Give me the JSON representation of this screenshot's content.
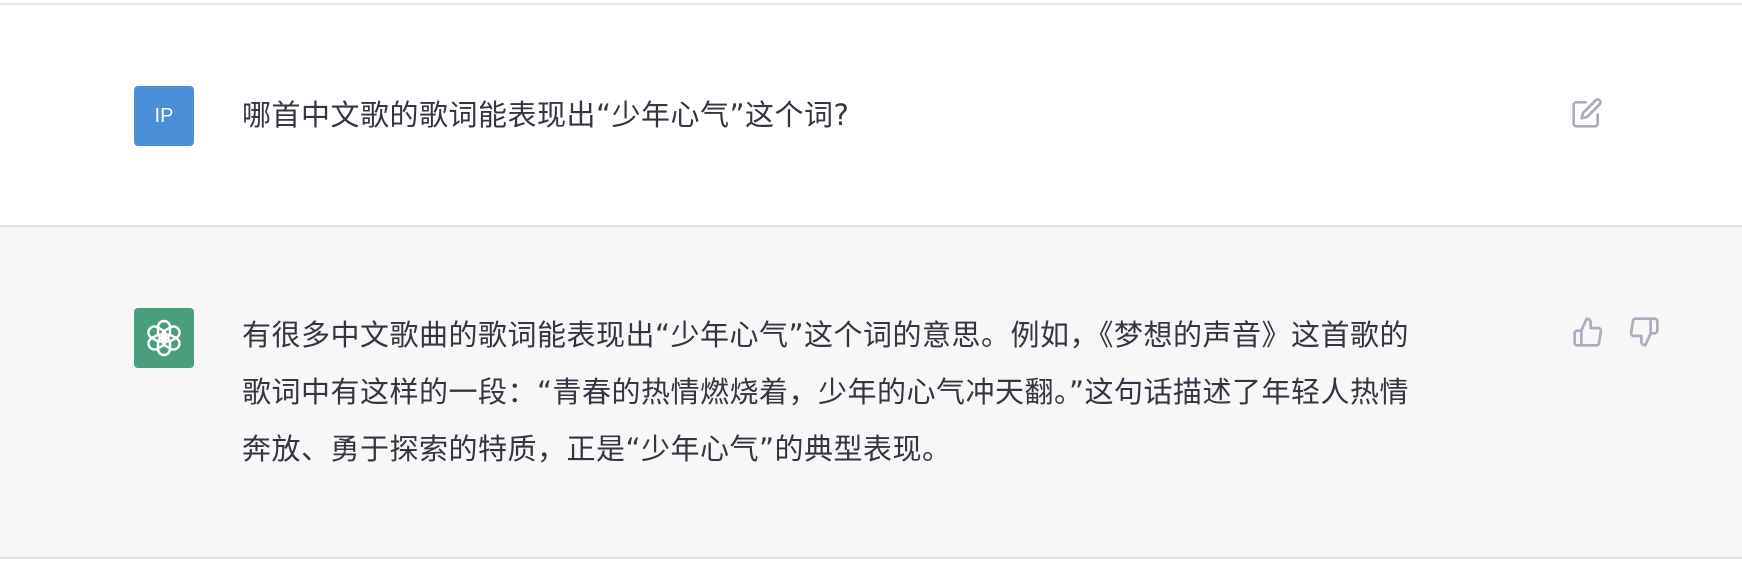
{
  "conversation": {
    "user_message": {
      "avatar_text": "IP",
      "text": "哪首中文歌的歌词能表现出“少年心气”这个词?"
    },
    "assistant_message": {
      "lines": [
        "有很多中文歌曲的歌词能表现出“少年心气”这个词的意思。例如，《梦想的声音》这首歌的",
        "歌词中有这样的一段：“青春的热情燃烧着，少年的心气冲天翻。”这句话描述了年轻人热情",
        "奔放、勇于探索的特质，正是“少年心气”的典型表现。"
      ]
    }
  },
  "icons": {
    "edit": "edit-icon",
    "assistant_logo": "openai-logo-icon",
    "like": "thumbs-up-icon",
    "dislike": "thumbs-down-icon"
  },
  "colors": {
    "user_avatar_bg": "#4a90d9",
    "assistant_avatar_bg": "#4a9e7e",
    "assistant_row_bg": "#f7f7f8",
    "text": "#343541",
    "icon": "#acacbe"
  }
}
